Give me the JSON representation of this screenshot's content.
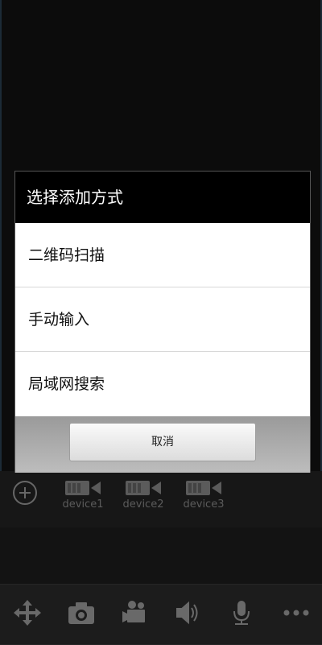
{
  "dialog": {
    "title": "选择添加方式",
    "options": [
      "二维码扫描",
      "手动输入",
      "局域网搜索"
    ],
    "cancel_label": "取消"
  },
  "devices": [
    {
      "label": "device1"
    },
    {
      "label": "device2"
    },
    {
      "label": "device3"
    }
  ],
  "toolbar": {
    "icons": [
      "move-icon",
      "camera-icon",
      "record-icon",
      "speaker-icon",
      "microphone-icon",
      "more-icon"
    ]
  }
}
